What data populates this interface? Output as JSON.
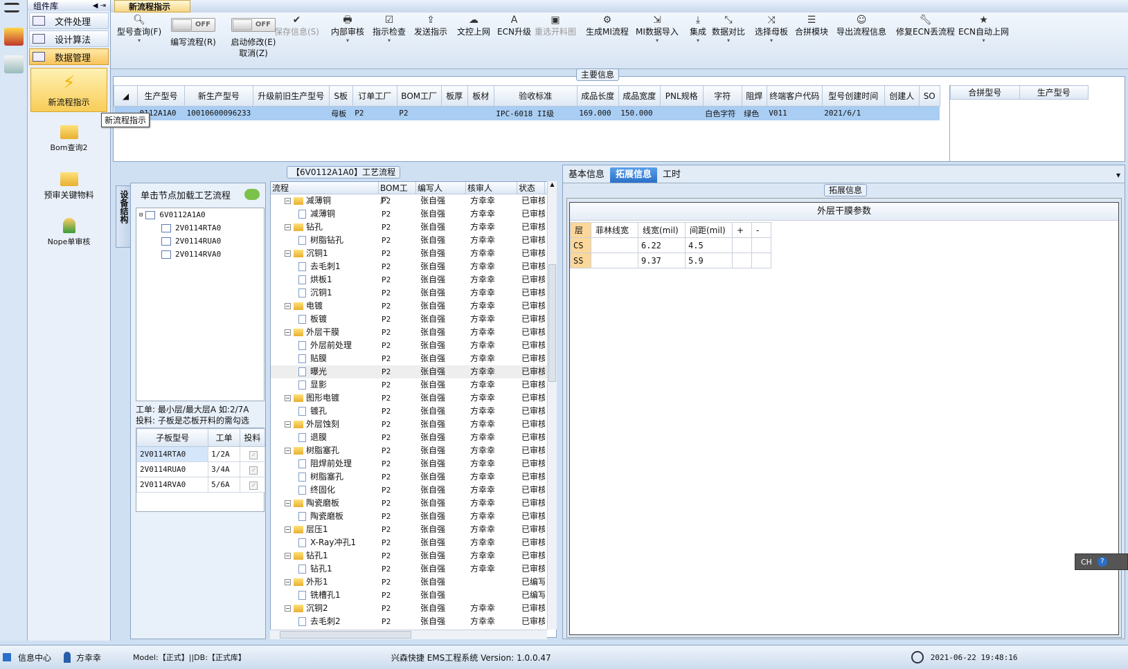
{
  "app": {
    "component_lib": "组件库",
    "doc_tab": "新流程指示"
  },
  "component_menu": [
    {
      "label": "文件处理",
      "active": false
    },
    {
      "label": "设计算法",
      "active": false
    },
    {
      "label": "数据管理",
      "active": true
    }
  ],
  "component_tools": [
    {
      "label": "新流程指示",
      "active": true
    },
    {
      "label": "Bom查询2",
      "active": false
    },
    {
      "label": "预审关键物料",
      "active": false
    },
    {
      "label": "Nope单审核",
      "active": false
    }
  ],
  "tooltip": "新流程指示",
  "toolbar": {
    "type_query": "型号查询(F)",
    "edit_flow": "编写流程(R)",
    "edit_toggle": "OFF",
    "start_modify": "启动修改(E)",
    "start_toggle": "OFF",
    "cancel": "取消(Z)",
    "buttons": [
      "保存信息(S)",
      "内部审核",
      "指示检查",
      "发送指示",
      "文控上网",
      "ECN升级",
      "重选开料图",
      "生成MI流程",
      "MI数据导入",
      "集成",
      "数据对比",
      "选择母板",
      "合拼模块",
      "导出流程信息",
      "修复ECN丢流程",
      "ECN自动上网"
    ]
  },
  "main_info": {
    "title": "主要信息",
    "headers": [
      "生产型号",
      "新生产型号",
      "升级前旧生产型号",
      "S板",
      "订单工厂",
      "BOM工厂",
      "板厚",
      "板材",
      "验收标准",
      "成品长度",
      "成品宽度",
      "PNL规格",
      "字符",
      "阻焊",
      "终端客户代码",
      "型号创建时间",
      "创建人",
      "SO"
    ],
    "row": [
      "0112A1A0",
      "10010600096233",
      "",
      "母板",
      "P2",
      "P2",
      "",
      "",
      "IPC-6018 II级",
      "169.000",
      "150.000",
      "",
      "白色字符",
      "绿色",
      "V011",
      "2021/6/1",
      "",
      ""
    ],
    "merge_headers": [
      "合拼型号",
      "生产型号"
    ]
  },
  "process": {
    "title": "【6V0112A1A0】工艺流程",
    "vertical_tab": "设备结构",
    "hint": "单击节点加载工艺流程",
    "tree_root": "6V0112A1A0",
    "tree_children": [
      "2V0114RTA0",
      "2V0114RUA0",
      "2V0114RVA0"
    ],
    "note1": "工单: 最小层/最大层A 如:2/7A",
    "note2": "投料: 子板是芯板开料的需勾选",
    "sub_headers": [
      "子板型号",
      "工单",
      "投料"
    ],
    "sub_rows": [
      {
        "model": "2V0114RTA0",
        "order": "1/2A"
      },
      {
        "model": "2V0114RUA0",
        "order": "3/4A"
      },
      {
        "model": "2V0114RVA0",
        "order": "5/6A"
      }
    ],
    "columns": [
      "流程",
      "BOM工厂",
      "编写人",
      "核审人",
      "状态"
    ],
    "rows": [
      {
        "name": "减薄铜",
        "level": 1,
        "factory": "P2",
        "writer": "张自强",
        "reviewer": "方幸幸",
        "status": "已审核"
      },
      {
        "name": "减薄铜",
        "level": 2,
        "factory": "P2",
        "writer": "张自强",
        "reviewer": "方幸幸",
        "status": "已审核"
      },
      {
        "name": "钻孔",
        "level": 1,
        "factory": "P2",
        "writer": "张自强",
        "reviewer": "方幸幸",
        "status": "已审核"
      },
      {
        "name": "树脂钻孔",
        "level": 2,
        "factory": "P2",
        "writer": "张自强",
        "reviewer": "方幸幸",
        "status": "已审核"
      },
      {
        "name": "沉铜1",
        "level": 1,
        "factory": "P2",
        "writer": "张自强",
        "reviewer": "方幸幸",
        "status": "已审核"
      },
      {
        "name": "去毛刺1",
        "level": 2,
        "factory": "P2",
        "writer": "张自强",
        "reviewer": "方幸幸",
        "status": "已审核"
      },
      {
        "name": "烘板1",
        "level": 2,
        "factory": "P2",
        "writer": "张自强",
        "reviewer": "方幸幸",
        "status": "已审核"
      },
      {
        "name": "沉铜1",
        "level": 2,
        "factory": "P2",
        "writer": "张自强",
        "reviewer": "方幸幸",
        "status": "已审核"
      },
      {
        "name": "电镀",
        "level": 1,
        "factory": "P2",
        "writer": "张自强",
        "reviewer": "方幸幸",
        "status": "已审核"
      },
      {
        "name": "板镀",
        "level": 2,
        "factory": "P2",
        "writer": "张自强",
        "reviewer": "方幸幸",
        "status": "已审核"
      },
      {
        "name": "外层干膜",
        "level": 1,
        "factory": "P2",
        "writer": "张自强",
        "reviewer": "方幸幸",
        "status": "已审核"
      },
      {
        "name": "外层前处理",
        "level": 2,
        "factory": "P2",
        "writer": "张自强",
        "reviewer": "方幸幸",
        "status": "已审核"
      },
      {
        "name": "贴膜",
        "level": 2,
        "factory": "P2",
        "writer": "张自强",
        "reviewer": "方幸幸",
        "status": "已审核"
      },
      {
        "name": "曝光",
        "level": 2,
        "factory": "P2",
        "writer": "张自强",
        "reviewer": "方幸幸",
        "status": "已审核",
        "selected": true
      },
      {
        "name": "显影",
        "level": 2,
        "factory": "P2",
        "writer": "张自强",
        "reviewer": "方幸幸",
        "status": "已审核"
      },
      {
        "name": "图形电镀",
        "level": 1,
        "factory": "P2",
        "writer": "张自强",
        "reviewer": "方幸幸",
        "status": "已审核"
      },
      {
        "name": "镀孔",
        "level": 2,
        "factory": "P2",
        "writer": "张自强",
        "reviewer": "方幸幸",
        "status": "已审核"
      },
      {
        "name": "外层蚀刻",
        "level": 1,
        "factory": "P2",
        "writer": "张自强",
        "reviewer": "方幸幸",
        "status": "已审核"
      },
      {
        "name": "退膜",
        "level": 2,
        "factory": "P2",
        "writer": "张自强",
        "reviewer": "方幸幸",
        "status": "已审核"
      },
      {
        "name": "树脂塞孔",
        "level": 1,
        "factory": "P2",
        "writer": "张自强",
        "reviewer": "方幸幸",
        "status": "已审核"
      },
      {
        "name": "阻焊前处理",
        "level": 2,
        "factory": "P2",
        "writer": "张自强",
        "reviewer": "方幸幸",
        "status": "已审核"
      },
      {
        "name": "树脂塞孔",
        "level": 2,
        "factory": "P2",
        "writer": "张自强",
        "reviewer": "方幸幸",
        "status": "已审核"
      },
      {
        "name": "终固化",
        "level": 2,
        "factory": "P2",
        "writer": "张自强",
        "reviewer": "方幸幸",
        "status": "已审核"
      },
      {
        "name": "陶瓷磨板",
        "level": 1,
        "factory": "P2",
        "writer": "张自强",
        "reviewer": "方幸幸",
        "status": "已审核"
      },
      {
        "name": "陶瓷磨板",
        "level": 2,
        "factory": "P2",
        "writer": "张自强",
        "reviewer": "方幸幸",
        "status": "已审核"
      },
      {
        "name": "层压1",
        "level": 1,
        "factory": "P2",
        "writer": "张自强",
        "reviewer": "方幸幸",
        "status": "已审核"
      },
      {
        "name": "X-Ray冲孔1",
        "level": 2,
        "factory": "P2",
        "writer": "张自强",
        "reviewer": "方幸幸",
        "status": "已审核"
      },
      {
        "name": "钻孔1",
        "level": 1,
        "factory": "P2",
        "writer": "张自强",
        "reviewer": "方幸幸",
        "status": "已审核"
      },
      {
        "name": "钻孔1",
        "level": 2,
        "factory": "P2",
        "writer": "张自强",
        "reviewer": "方幸幸",
        "status": "已审核"
      },
      {
        "name": "外形1",
        "level": 1,
        "factory": "P2",
        "writer": "张自强",
        "reviewer": "",
        "status": "已编写"
      },
      {
        "name": "铣槽孔1",
        "level": 2,
        "factory": "P2",
        "writer": "张自强",
        "reviewer": "",
        "status": "已编写"
      },
      {
        "name": "沉铜2",
        "level": 1,
        "factory": "P2",
        "writer": "张自强",
        "reviewer": "方幸幸",
        "status": "已审核"
      },
      {
        "name": "去毛刺2",
        "level": 2,
        "factory": "P2",
        "writer": "张自强",
        "reviewer": "方幸幸",
        "status": "已审核"
      }
    ]
  },
  "right": {
    "tabs": [
      {
        "label": "基本信息",
        "active": false
      },
      {
        "label": "拓展信息",
        "active": true
      },
      {
        "label": "工时",
        "active": false
      }
    ],
    "group_title": "拓展信息",
    "table_title": "外层干膜参数",
    "headers": [
      "层",
      "菲林线宽",
      "线宽(mil)",
      "间距(mil)",
      "+",
      "-"
    ],
    "rows": [
      {
        "layer": "CS",
        "film": "",
        "width": "6.22",
        "space": "4.5"
      },
      {
        "layer": "SS",
        "film": "",
        "width": "9.37",
        "space": "5.9"
      }
    ]
  },
  "status": {
    "info_center": "信息中心",
    "user": "方幸幸",
    "model": "Model:【正式】||DB:【正式库】",
    "app_name": "兴森快捷 EMS工程系统 Version: 1.0.0.47",
    "datetime": "2021-06-22 19:48:16",
    "ime": "CH"
  }
}
